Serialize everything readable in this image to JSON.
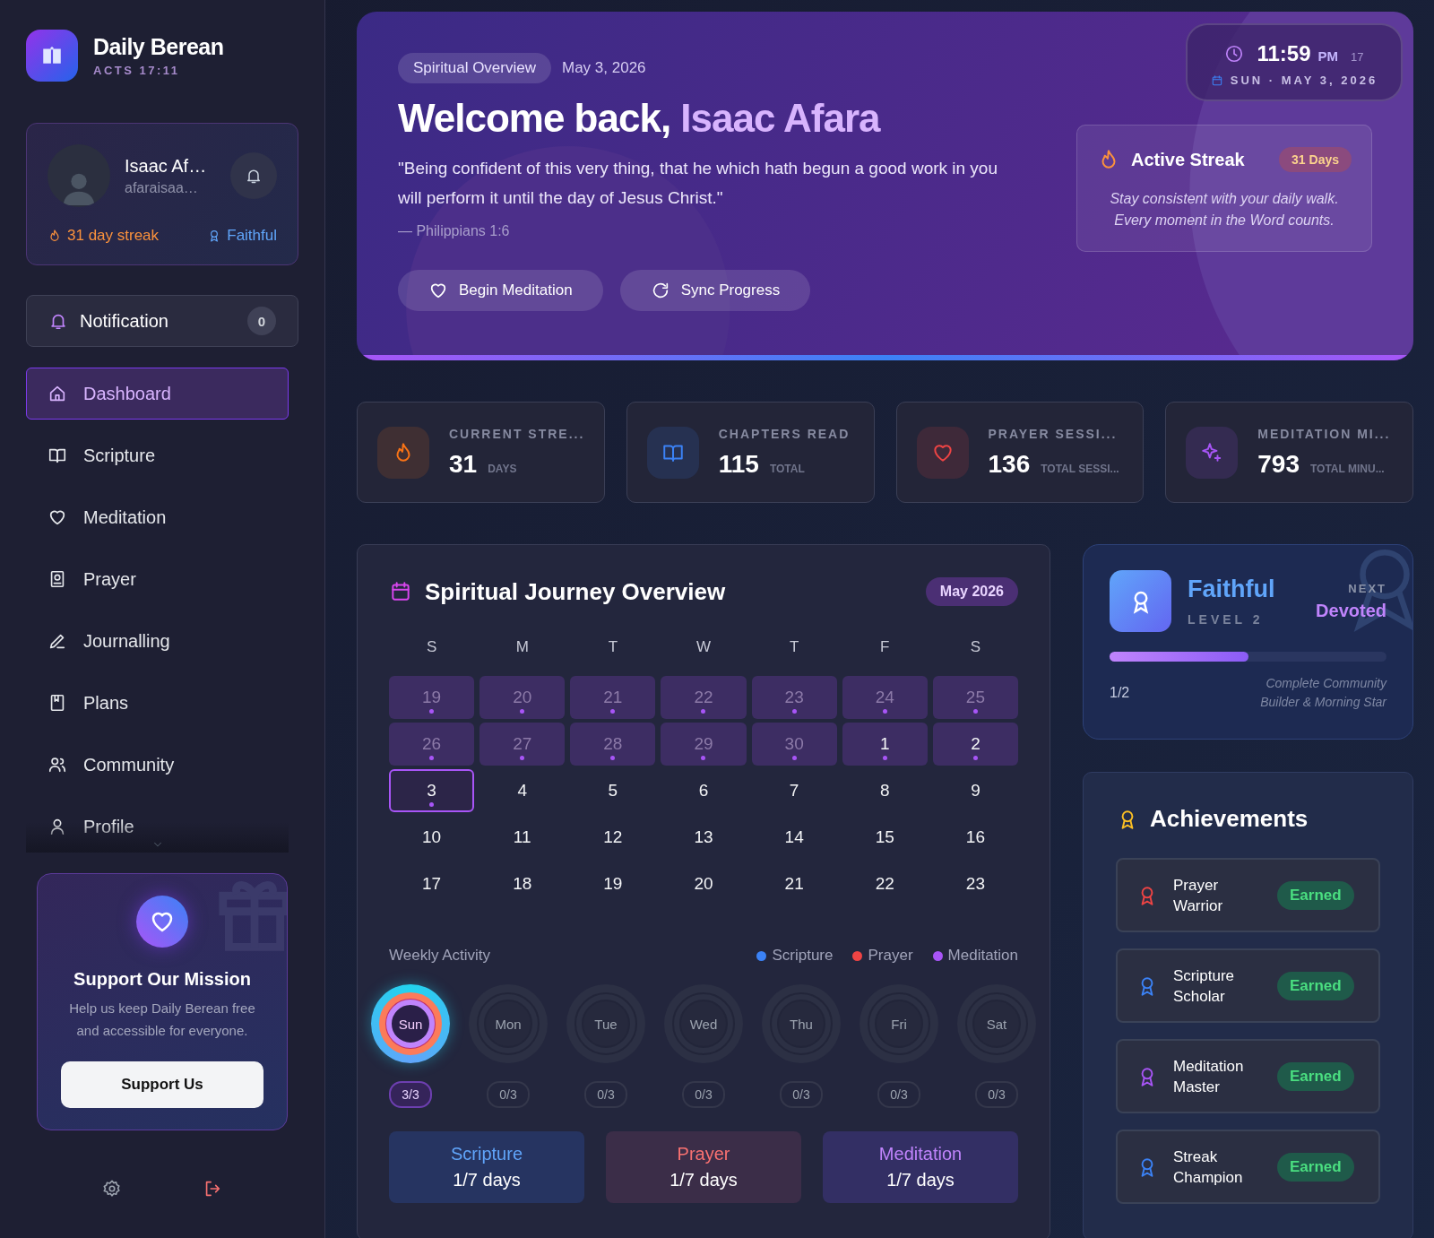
{
  "brand": {
    "title": "Daily Berean",
    "subtitle": "ACTS 17:11"
  },
  "profile": {
    "name": "Isaac Af…",
    "email": "afaraisaa…",
    "streak": "31 day streak",
    "rank": "Faithful"
  },
  "notification": {
    "label": "Notification",
    "count": "0"
  },
  "nav": [
    {
      "label": "Dashboard",
      "kind": "home",
      "selected": true
    },
    {
      "label": "Scripture",
      "kind": "book",
      "selected": false
    },
    {
      "label": "Meditation",
      "kind": "heart",
      "selected": false
    },
    {
      "label": "Prayer",
      "kind": "prayer",
      "selected": false
    },
    {
      "label": "Journalling",
      "kind": "pen",
      "selected": false
    },
    {
      "label": "Plans",
      "kind": "plans",
      "selected": false
    },
    {
      "label": "Community",
      "kind": "users",
      "selected": false
    },
    {
      "label": "Profile",
      "kind": "user",
      "selected": false
    }
  ],
  "support": {
    "title": "Support Our Mission",
    "text": "Help us keep Daily Berean free and accessible for everyone.",
    "button": "Support Us"
  },
  "hero": {
    "tag": "Spiritual Overview",
    "date": "May 3, 2026",
    "greeting": "Welcome back,",
    "name": "Isaac Afara",
    "verse": "\"Being confident of this very thing, that he which hath begun a good work in you will perform it until the day of Jesus Christ.\"",
    "reference": "— Philippians 1:6",
    "buttons": [
      {
        "label": "Begin Meditation",
        "kind": "heart"
      },
      {
        "label": "Sync Progress",
        "kind": "refresh"
      }
    ]
  },
  "clock": {
    "time": "11:59",
    "period": "PM",
    "seconds": "17",
    "date": "SUN · MAY 3, 2026"
  },
  "streak_card": {
    "title": "Active Streak",
    "badge": "31 Days",
    "text": "Stay consistent with your daily walk. Every moment in the Word counts."
  },
  "stats": [
    {
      "label": "CURRENT STRE...",
      "value": "31",
      "unit": "DAYS",
      "kind": "flame",
      "color": "#f97316"
    },
    {
      "label": "CHAPTERS READ",
      "value": "115",
      "unit": "TOTAL",
      "kind": "book",
      "color": "#3b82f6"
    },
    {
      "label": "PRAYER SESSI...",
      "value": "136",
      "unit": "TOTAL SESSI...",
      "kind": "heart",
      "color": "#ef4444"
    },
    {
      "label": "MEDITATION MI...",
      "value": "793",
      "unit": "TOTAL MINU...",
      "kind": "sparkle",
      "color": "#a855f7"
    }
  ],
  "calendar": {
    "title": "Spiritual Journey Overview",
    "month": "May 2026",
    "weekdays": [
      "S",
      "M",
      "T",
      "W",
      "T",
      "F",
      "S"
    ],
    "weeks": [
      [
        {
          "label": "19",
          "outside": true,
          "active": true,
          "selected": false
        },
        {
          "label": "20",
          "outside": true,
          "active": true,
          "selected": false
        },
        {
          "label": "21",
          "outside": true,
          "active": true,
          "selected": false
        },
        {
          "label": "22",
          "outside": true,
          "active": true,
          "selected": false
        },
        {
          "label": "23",
          "outside": true,
          "active": true,
          "selected": false
        },
        {
          "label": "24",
          "outside": true,
          "active": true,
          "selected": false
        },
        {
          "label": "25",
          "outside": true,
          "active": true,
          "selected": false
        }
      ],
      [
        {
          "label": "26",
          "outside": true,
          "active": true,
          "selected": false
        },
        {
          "label": "27",
          "outside": true,
          "active": true,
          "selected": false
        },
        {
          "label": "28",
          "outside": true,
          "active": true,
          "selected": false
        },
        {
          "label": "29",
          "outside": true,
          "active": true,
          "selected": false
        },
        {
          "label": "30",
          "outside": true,
          "active": true,
          "selected": false
        },
        {
          "label": "1",
          "outside": false,
          "active": true,
          "selected": false
        },
        {
          "label": "2",
          "outside": false,
          "active": true,
          "selected": false
        }
      ],
      [
        {
          "label": "3",
          "outside": false,
          "active": true,
          "selected": true
        },
        {
          "label": "4",
          "outside": false,
          "active": false,
          "selected": false
        },
        {
          "label": "5",
          "outside": false,
          "active": false,
          "selected": false
        },
        {
          "label": "6",
          "outside": false,
          "active": false,
          "selected": false
        },
        {
          "label": "7",
          "outside": false,
          "active": false,
          "selected": false
        },
        {
          "label": "8",
          "outside": false,
          "active": false,
          "selected": false
        },
        {
          "label": "9",
          "outside": false,
          "active": false,
          "selected": false
        }
      ],
      [
        {
          "label": "10",
          "outside": false,
          "active": false,
          "selected": false
        },
        {
          "label": "11",
          "outside": false,
          "active": false,
          "selected": false
        },
        {
          "label": "12",
          "outside": false,
          "active": false,
          "selected": false
        },
        {
          "label": "13",
          "outside": false,
          "active": false,
          "selected": false
        },
        {
          "label": "14",
          "outside": false,
          "active": false,
          "selected": false
        },
        {
          "label": "15",
          "outside": false,
          "active": false,
          "selected": false
        },
        {
          "label": "16",
          "outside": false,
          "active": false,
          "selected": false
        }
      ],
      [
        {
          "label": "17",
          "outside": false,
          "active": false,
          "selected": false
        },
        {
          "label": "18",
          "outside": false,
          "active": false,
          "selected": false
        },
        {
          "label": "19",
          "outside": false,
          "active": false,
          "selected": false
        },
        {
          "label": "20",
          "outside": false,
          "active": false,
          "selected": false
        },
        {
          "label": "21",
          "outside": false,
          "active": false,
          "selected": false
        },
        {
          "label": "22",
          "outside": false,
          "active": false,
          "selected": false
        },
        {
          "label": "23",
          "outside": false,
          "active": false,
          "selected": false
        }
      ]
    ]
  },
  "weekly": {
    "title": "Weekly Activity",
    "legend": [
      {
        "label": "Scripture",
        "color": "#3b82f6"
      },
      {
        "label": "Prayer",
        "color": "#ef4444"
      },
      {
        "label": "Meditation",
        "color": "#a855f7"
      }
    ],
    "days": [
      {
        "label": "Sun",
        "count": "3/3",
        "complete": true
      },
      {
        "label": "Mon",
        "count": "0/3",
        "complete": false
      },
      {
        "label": "Tue",
        "count": "0/3",
        "complete": false
      },
      {
        "label": "Wed",
        "count": "0/3",
        "complete": false
      },
      {
        "label": "Thu",
        "count": "0/3",
        "complete": false
      },
      {
        "label": "Fri",
        "count": "0/3",
        "complete": false
      },
      {
        "label": "Sat",
        "count": "0/3",
        "complete": false
      }
    ],
    "summary": [
      {
        "label": "Scripture",
        "value": "1/7 days",
        "kind": "scripture"
      },
      {
        "label": "Prayer",
        "value": "1/7 days",
        "kind": "prayer"
      },
      {
        "label": "Meditation",
        "value": "1/7 days",
        "kind": "meditation"
      }
    ]
  },
  "level": {
    "name": "Faithful",
    "rank": "LEVEL 2",
    "next_label": "NEXT",
    "next": "Devoted",
    "level": 0.5,
    "count": "1/2",
    "hint": "Complete Community Builder & Morning Star"
  },
  "achievements": {
    "title": "Achievements",
    "items": [
      {
        "name": "Prayer Warrior",
        "badge": "Earned",
        "color": "#ef4444"
      },
      {
        "name": "Scripture Scholar",
        "badge": "Earned",
        "color": "#3b82f6"
      },
      {
        "name": "Meditation Master",
        "badge": "Earned",
        "color": "#a855f7"
      },
      {
        "name": "Streak Champion",
        "badge": "Earned",
        "color": "#3b82f6"
      }
    ]
  }
}
